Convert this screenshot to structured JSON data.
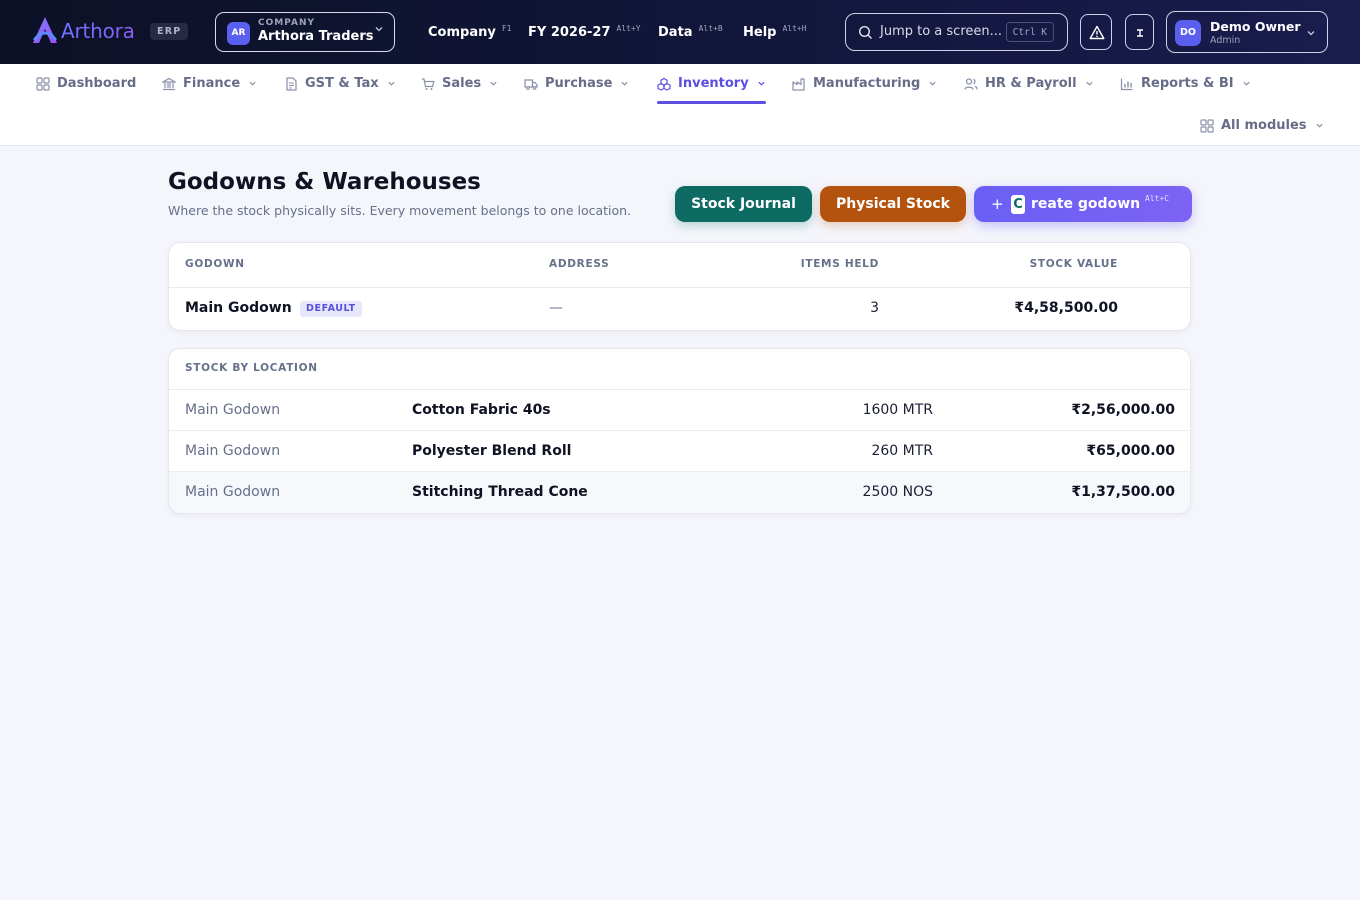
{
  "brand": {
    "name": "Arthora",
    "badge": "ERP",
    "colors": {
      "accent": "#5b4fe0",
      "topbar": "#0c1126",
      "journal_btn": "#0d6b63",
      "physical_btn": "#b4530d",
      "create_btn": "#6a5ff5"
    }
  },
  "company": {
    "label": "COMPANY",
    "initials": "AR",
    "name": "Arthora Traders"
  },
  "topmenu": [
    {
      "label": "Company",
      "shortcut": "F1"
    },
    {
      "label": "FY 2026-27",
      "shortcut": "Alt+Y"
    },
    {
      "label": "Data",
      "shortcut": "Alt+B"
    },
    {
      "label": "Help",
      "shortcut": "Alt+H"
    }
  ],
  "search": {
    "placeholder": "Jump to a screen...",
    "shortcut": "Ctrl K"
  },
  "user": {
    "initials": "DO",
    "name": "Demo Owner",
    "role": "Admin"
  },
  "modules": [
    {
      "label": "Dashboard",
      "icon": "grid-icon"
    },
    {
      "label": "Finance",
      "icon": "bank-icon"
    },
    {
      "label": "GST & Tax",
      "icon": "document-icon"
    },
    {
      "label": "Sales",
      "icon": "cart-icon"
    },
    {
      "label": "Purchase",
      "icon": "truck-icon"
    },
    {
      "label": "Inventory",
      "icon": "boxes-icon",
      "active": true
    },
    {
      "label": "Manufacturing",
      "icon": "factory-icon"
    },
    {
      "label": "HR & Payroll",
      "icon": "users-icon"
    },
    {
      "label": "Reports & BI",
      "icon": "bar-chart-icon"
    },
    {
      "label": "All modules",
      "icon": "grid-icon"
    }
  ],
  "page": {
    "title": "Godowns & Warehouses",
    "subtitle": "Where the stock physically sits. Every movement belongs to one location."
  },
  "actions": {
    "stock_journal": "Stock Journal",
    "physical_stock": "Physical Stock",
    "create_plus": "+",
    "create_key": "C",
    "create_label": "reate godown",
    "create_shortcut": "Alt+C"
  },
  "godowns": {
    "columns": [
      "GODOWN",
      "ADDRESS",
      "ITEMS HELD",
      "STOCK VALUE"
    ],
    "rows": [
      {
        "name": "Main Godown",
        "badge": "DEFAULT",
        "address": "—",
        "items": "3",
        "value": "₹4,58,500.00"
      }
    ]
  },
  "stock_by_location": {
    "title": "STOCK BY LOCATION",
    "rows": [
      {
        "location": "Main Godown",
        "item": "Cotton Fabric 40s",
        "qty": "1600 MTR",
        "value": "₹2,56,000.00"
      },
      {
        "location": "Main Godown",
        "item": "Polyester Blend Roll",
        "qty": "260 MTR",
        "value": "₹65,000.00"
      },
      {
        "location": "Main Godown",
        "item": "Stitching Thread Cone",
        "qty": "2500 NOS",
        "value": "₹1,37,500.00"
      }
    ]
  }
}
